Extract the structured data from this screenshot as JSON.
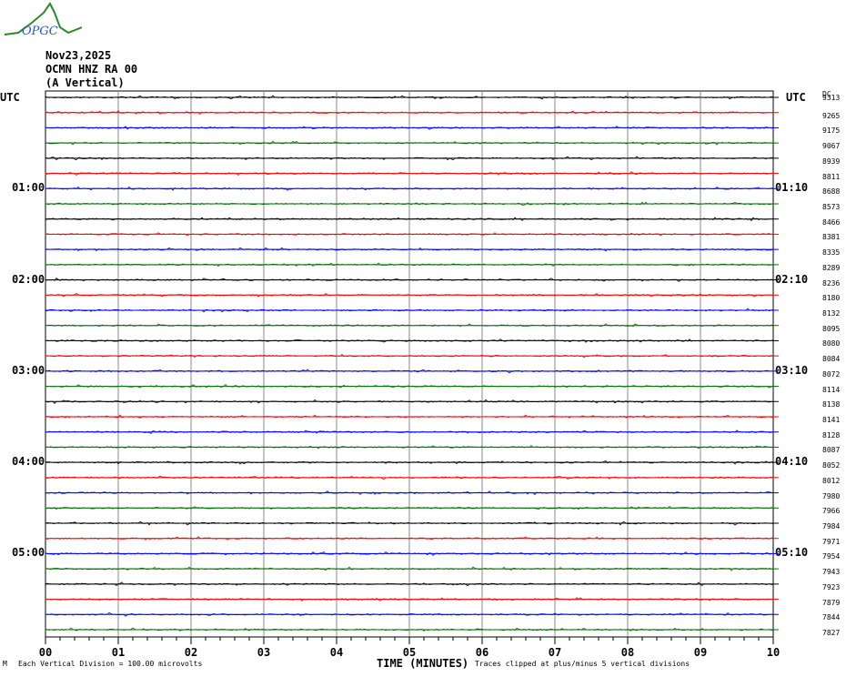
{
  "logo_text": "OPGC",
  "header": {
    "date": "Nov23,2025",
    "station": "OCMN HNZ RA 00",
    "component": "(A Vertical)"
  },
  "left_axis": {
    "title": "UTC",
    "labels": [
      "01:00",
      "02:00",
      "03:00",
      "04:00",
      "05:00"
    ]
  },
  "right_axis": {
    "title": "UTC",
    "labels": [
      "01:10",
      "02:10",
      "03:10",
      "04:10",
      "05:10"
    ],
    "dc_title": "DC",
    "dc_values": [
      "9313",
      "9265",
      "9175",
      "9067",
      "8939",
      "8811",
      "8688",
      "8573",
      "8466",
      "8381",
      "8335",
      "8289",
      "8236",
      "8180",
      "8132",
      "8095",
      "8080",
      "8084",
      "8072",
      "8114",
      "8138",
      "8141",
      "8128",
      "8087",
      "8052",
      "8012",
      "7980",
      "7966",
      "7984",
      "7971",
      "7954",
      "7943",
      "7923",
      "7879",
      "7844",
      "7827"
    ]
  },
  "chart_data": {
    "type": "line",
    "title": "OCMN HNZ RA 00 helicorder",
    "xlabel": "TIME (MINUTES)",
    "x_ticks": [
      "00",
      "01",
      "02",
      "03",
      "04",
      "05",
      "06",
      "07",
      "08",
      "09",
      "10"
    ],
    "xlim": [
      0,
      10
    ],
    "trace_count": 36,
    "trace_colors": [
      "#000000",
      "#ff0000",
      "#0000ff",
      "#007000"
    ],
    "grid": true
  },
  "footer": {
    "scale_icon": "M",
    "scale": "Each Vertical Division =  100.00 microvolts",
    "clip": "Traces clipped at plus/minus 5 vertical divisions"
  }
}
